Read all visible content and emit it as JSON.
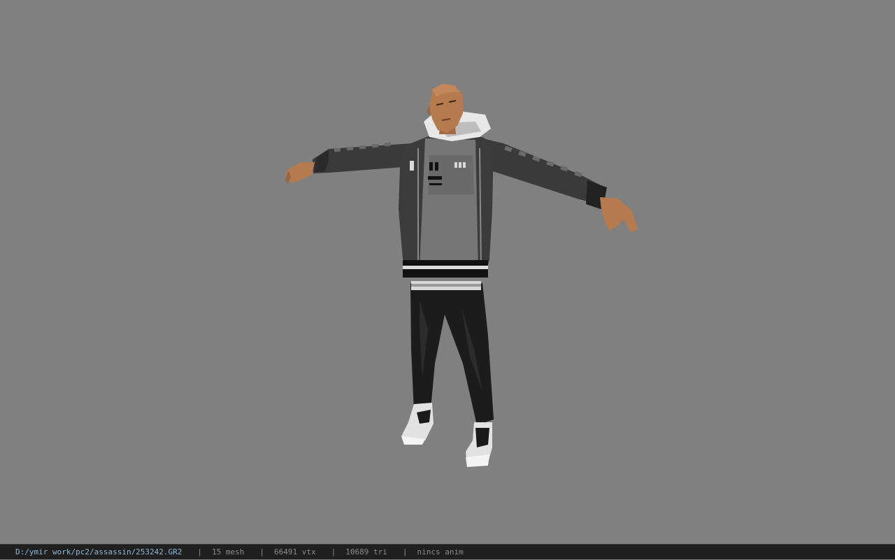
{
  "status": {
    "file_path": "D:/ymir work/pc2/assassin/253242.GR2",
    "separator": "|",
    "mesh": "15 mesh",
    "vertices": "66491 vtx",
    "triangles": "10689 tri",
    "anim": "nincs anim"
  },
  "colors": {
    "viewport_bg": "#808080",
    "statusbar_bg": "#1f1f1f",
    "path_text": "#8fb8d8",
    "stat_text": "#8c8c8c"
  }
}
